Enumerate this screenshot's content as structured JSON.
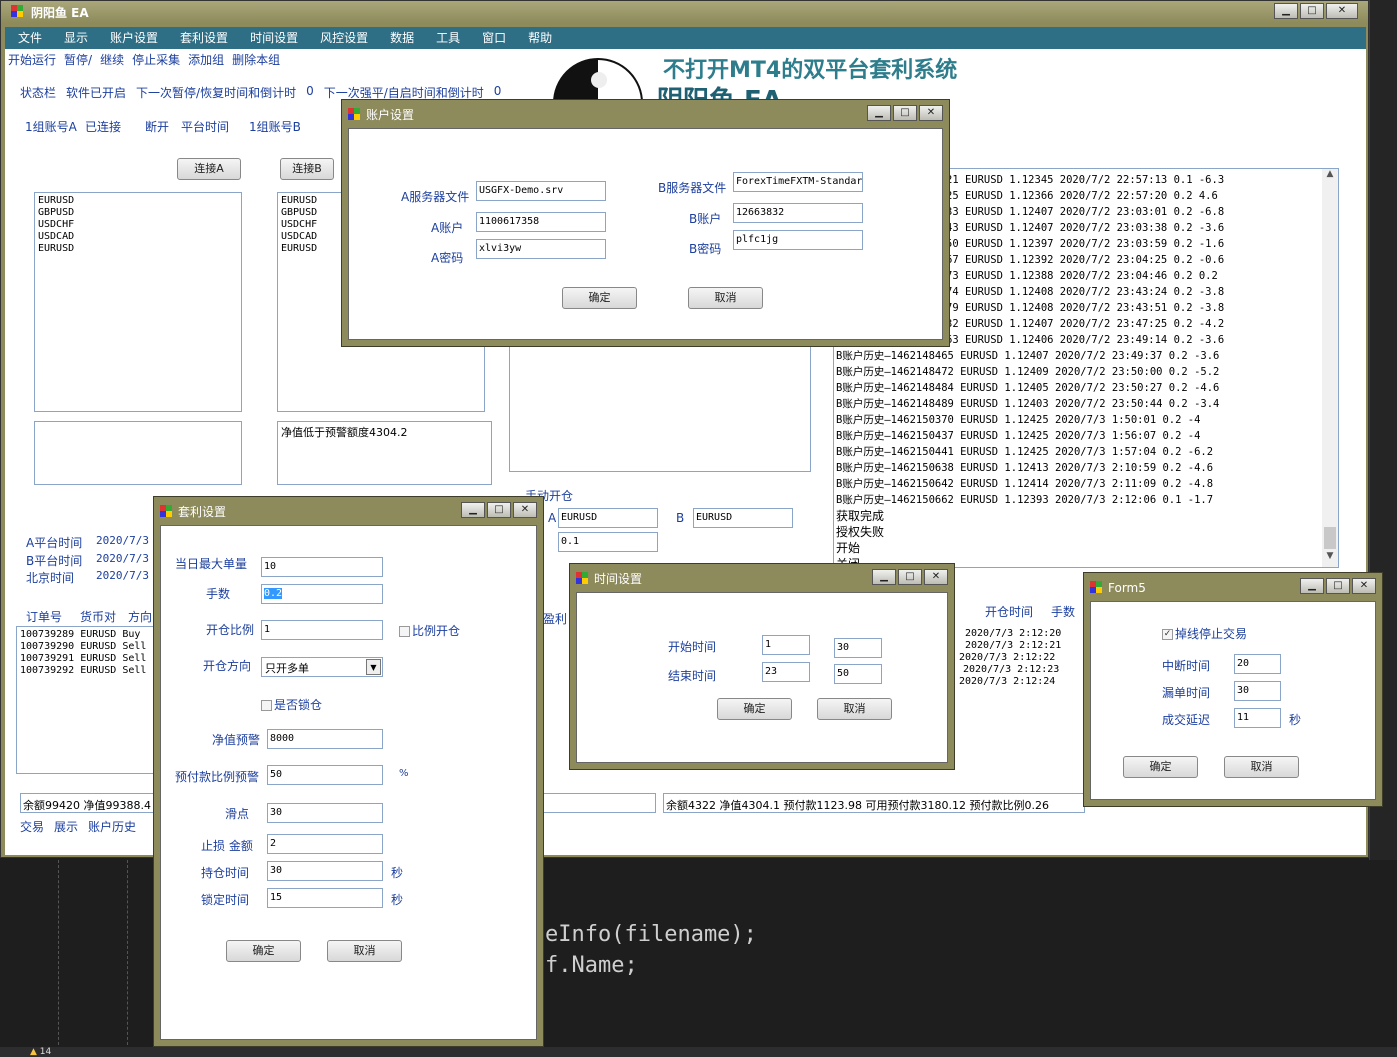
{
  "main": {
    "title": "阴阳鱼 EA",
    "menu": [
      "文件",
      "显示",
      "账户设置",
      "套利设置",
      "时间设置",
      "风控设置",
      "数据",
      "工具",
      "窗口",
      "帮助"
    ],
    "toolbar": [
      "开始运行",
      "暂停/",
      "继续",
      "停止采集",
      "添加组",
      "删除本组"
    ],
    "banner": "不打开MT4的双平台套利系统",
    "banner2": "阴阳鱼 EA",
    "status": {
      "label": "状态栏",
      "started": "软件已开启",
      "pause_text": "下一次暂停/恢复时间和倒计时",
      "pause_val": "0",
      "close_text": "下一次强平/自启时间和倒计时",
      "close_val": "0"
    },
    "group": {
      "a": "1组账号A",
      "connected": "已连接",
      "disconnect": "断开",
      "platform_time": "平台时间",
      "b": "1组账号B"
    },
    "connect_a": "连接A",
    "connect_b": "连接B",
    "symbols_a": [
      "EURUSD",
      "GBPUSD",
      "USDCHF",
      "USDCAD",
      "EURUSD"
    ],
    "symbols_b": [
      "EURUSD",
      "GBPUSD",
      "USDCHF",
      "USDCAD",
      "EURUSD"
    ],
    "warn": "净值低于预警额度4304.2",
    "times": [
      {
        "label": "A平台时间",
        "val": "2020/7/3"
      },
      {
        "label": "B平台时间",
        "val": "2020/7/3"
      },
      {
        "label": "北京时间",
        "val": "2020/7/3"
      }
    ],
    "order_headers": [
      "订单号",
      "货币对",
      "方向"
    ],
    "orders": [
      "100739289 EURUSD Buy",
      "100739290 EURUSD Sell",
      "100739291 EURUSD Sell",
      "100739292 EURUSD Sell"
    ],
    "balance_a": "余额99420  净值99388.4",
    "balance_b": "余额4322  净值4304.1  预付款1123.98  可用预付款3180.12  预付款比例0.26",
    "bottom_tabs": [
      "交易",
      "展示",
      "账户历史"
    ],
    "manual": {
      "title": "手动开仓",
      "a_label": "A",
      "a_val": "EURUSD",
      "b_label": "B",
      "b_val": "EURUSD",
      "lot": "0.1"
    },
    "profit_label": "盈利",
    "right_headers": [
      "开仓时间",
      "手数"
    ],
    "right_times": [
      "2020/7/3 2:12:20",
      "2020/7/3 2:12:21",
      "2020/7/3 2:12:22",
      "2020/7/3 2:12:23",
      "2020/7/3 2:12:24"
    ],
    "log_rows": [
      "21  EURUSD  1.12345  2020/7/2 22:57:13  0.1  -6.3",
      "25  EURUSD  1.12366  2020/7/2 22:57:20  0.2  4.6",
      "33  EURUSD  1.12407  2020/7/2 23:03:01  0.2  -6.8",
      "43  EURUSD  1.12407  2020/7/2 23:03:38  0.2  -3.6",
      "50  EURUSD  1.12397  2020/7/2 23:03:59  0.2  -1.6",
      "67  EURUSD  1.12392  2020/7/2 23:04:25  0.2  -0.6",
      "73  EURUSD  1.12388  2020/7/2 23:04:46  0.2  0.2",
      "74  EURUSD  1.12408  2020/7/2 23:43:24  0.2  -3.8",
      "79  EURUSD  1.12408  2020/7/2 23:43:51  0.2  -3.8",
      "32  EURUSD  1.12407  2020/7/2 23:47:25  0.2  -4.2",
      "63  EURUSD  1.12406  2020/7/2 23:49:14  0.2  -3.6",
      "B账户历史—1462148465  EURUSD  1.12407  2020/7/2 23:49:37  0.2  -3.6",
      "B账户历史—1462148472  EURUSD  1.12409  2020/7/2 23:50:00  0.2  -5.2",
      "B账户历史—1462148484  EURUSD  1.12405  2020/7/2 23:50:27  0.2  -4.6",
      "B账户历史—1462148489  EURUSD  1.12403  2020/7/2 23:50:44  0.2  -3.4",
      "B账户历史—1462150370  EURUSD  1.12425  2020/7/3 1:50:01  0.2  -4",
      "B账户历史—1462150437  EURUSD  1.12425  2020/7/3 1:56:07  0.2  -4",
      "B账户历史—1462150441  EURUSD  1.12425  2020/7/3 1:57:04  0.2  -6.2",
      "B账户历史—1462150638  EURUSD  1.12413  2020/7/3 2:10:59  0.2  -4.6",
      "B账户历史—1462150642  EURUSD  1.12414  2020/7/3 2:11:09  0.2  -4.8",
      "B账户历史—1462150662  EURUSD  1.12393  2020/7/3 2:12:06  0.1  -1.7"
    ],
    "log_tail": [
      "获取完成",
      "授权失败",
      "开始",
      "关闭"
    ]
  },
  "account": {
    "title": "账户设置",
    "a_server_label": "A服务器文件",
    "a_server": "USGFX-Demo.srv",
    "a_acc_label": "A账户",
    "a_acc": "1100617358",
    "a_pwd_label": "A密码",
    "a_pwd": "xlvi3yw",
    "b_server_label": "B服务器文件",
    "b_server": "ForexTimeFXTM-Standar",
    "b_acc_label": "B账户",
    "b_acc": "12663832",
    "b_pwd_label": "B密码",
    "b_pwd": "plfc1jg",
    "ok": "确定",
    "cancel": "取消"
  },
  "arb": {
    "title": "套利设置",
    "max_label": "当日最大单量",
    "max": "10",
    "lot_label": "手数",
    "lot": "0.2",
    "ratio_label": "开仓比例",
    "ratio": "1",
    "ratio_check": "比例开仓",
    "dir_label": "开仓方向",
    "dir": "只开多单",
    "lock_check": "是否锁仓",
    "equity_label": "净值预警",
    "equity": "8000",
    "margin_label": "预付款比例预警",
    "margin": "50",
    "pct": "%",
    "slip_label": "滑点",
    "slip": "30",
    "sl_label": "止损 金额",
    "sl": "2",
    "hold_label": "持仓时间",
    "hold": "30",
    "sec": "秒",
    "lock_label": "锁定时间",
    "lock": "15",
    "ok": "确定",
    "cancel": "取消"
  },
  "time": {
    "title": "时间设置",
    "start_label": "开始时间",
    "start_h": "1",
    "start_m": "30",
    "end_label": "结束时间",
    "end_h": "23",
    "end_m": "50",
    "ok": "确定",
    "cancel": "取消"
  },
  "form5": {
    "title": "Form5",
    "check": "掉线停止交易",
    "interrupt_label": "中断时间",
    "interrupt": "20",
    "miss_label": "漏单时间",
    "miss": "30",
    "delay_label": "成交延迟",
    "delay": "11",
    "sec": "秒",
    "ok": "确定",
    "cancel": "取消"
  },
  "ide": {
    "code1": "eInfo(filename);",
    "code2": "f.Name;",
    "status_count": "14"
  },
  "colors": {
    "titlebar": "#8d8a5c",
    "accent": "#1c3f9e",
    "banner": "#2e7d8c",
    "desktop": "#1e1e1e"
  }
}
